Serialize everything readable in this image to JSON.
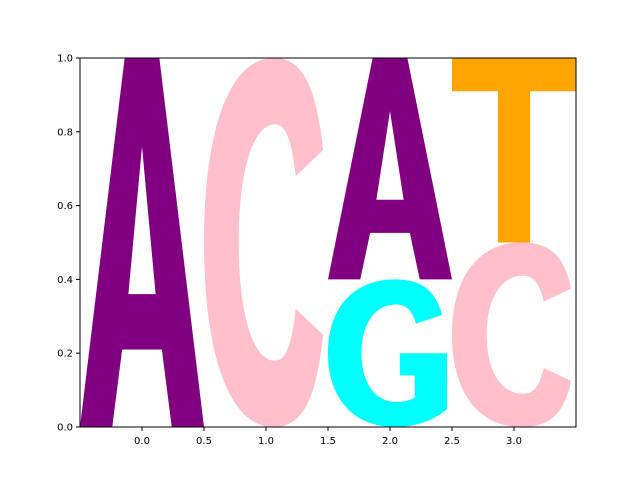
{
  "chart_data": {
    "type": "sequence-logo",
    "xlim": [
      -0.5,
      3.5
    ],
    "ylim": [
      0,
      1
    ],
    "x_ticks": [
      {
        "value": 0.0,
        "label": "0.0"
      },
      {
        "value": 0.5,
        "label": "0.5"
      },
      {
        "value": 1.0,
        "label": "1.0"
      },
      {
        "value": 1.5,
        "label": "1.5"
      },
      {
        "value": 2.0,
        "label": "2.0"
      },
      {
        "value": 2.5,
        "label": "2.5"
      },
      {
        "value": 3.0,
        "label": "3.0"
      }
    ],
    "y_ticks": [
      {
        "value": 0.0,
        "label": "0.0"
      },
      {
        "value": 0.2,
        "label": "0.2"
      },
      {
        "value": 0.4,
        "label": "0.4"
      },
      {
        "value": 0.6,
        "label": "0.6"
      },
      {
        "value": 0.8,
        "label": "0.8"
      },
      {
        "value": 1.0,
        "label": "1.0"
      }
    ],
    "colors": {
      "A": "#800080",
      "C": "#ffc0cb",
      "G": "#00ffff",
      "T": "#ffa500"
    },
    "positions": [
      {
        "x": 0,
        "letters": [
          {
            "letter": "A",
            "floor": 0.0,
            "height": 1.0
          }
        ]
      },
      {
        "x": 1,
        "letters": [
          {
            "letter": "C",
            "floor": 0.0,
            "height": 1.0
          }
        ]
      },
      {
        "x": 2,
        "letters": [
          {
            "letter": "G",
            "floor": 0.0,
            "height": 0.4
          },
          {
            "letter": "A",
            "floor": 0.4,
            "height": 0.6
          }
        ]
      },
      {
        "x": 3,
        "letters": [
          {
            "letter": "C",
            "floor": 0.0,
            "height": 0.5
          },
          {
            "letter": "T",
            "floor": 0.5,
            "height": 0.5
          }
        ]
      }
    ]
  }
}
